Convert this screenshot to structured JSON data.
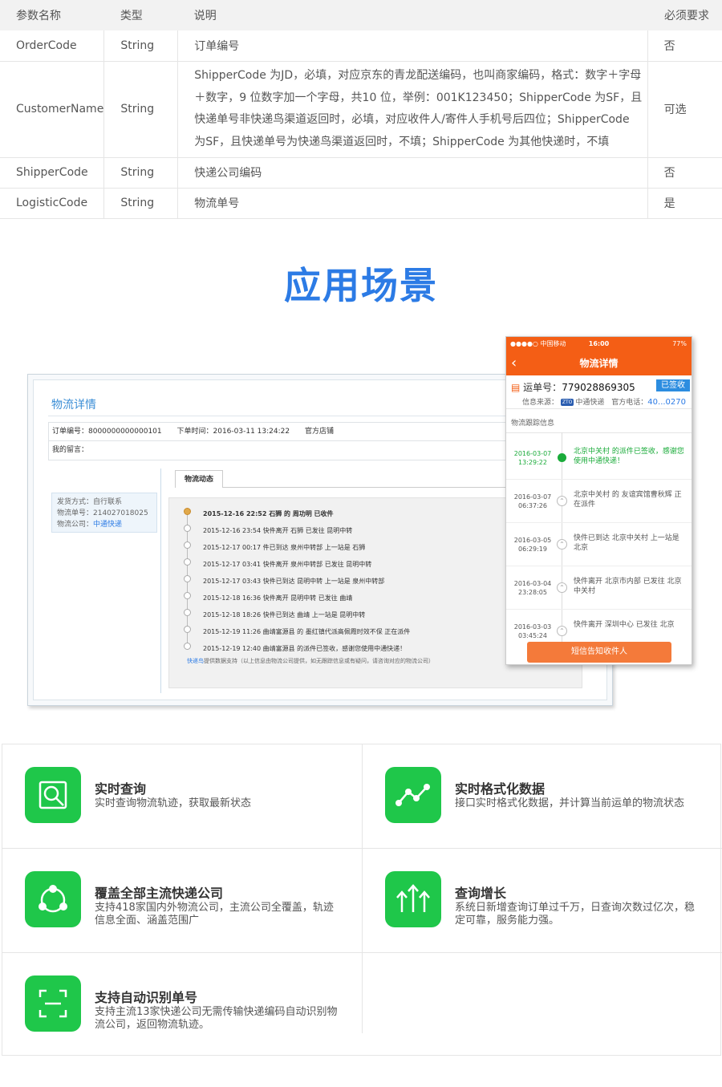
{
  "table": {
    "headers": [
      "参数名称",
      "类型",
      "说明",
      "必须要求"
    ],
    "rows": [
      {
        "name": "OrderCode",
        "type": "String",
        "desc": "订单编号",
        "req": "否"
      },
      {
        "name": "CustomerName",
        "type": "String",
        "desc": "ShipperCode 为JD，必填，对应京东的青龙配送编码，也叫商家编码，格式：数字＋字母＋数字，9 位数字加一个字母，共10 位，举例：001K123450；ShipperCode 为SF，且快递单号非快递鸟渠道返回时，必填，对应收件人/寄件人手机号后四位；ShipperCode 为SF，且快递单号为快递鸟渠道返回时，不填；ShipperCode 为其他快递时，不填",
        "req": "可选"
      },
      {
        "name": "ShipperCode",
        "type": "String",
        "desc": "快递公司编码",
        "req": "否"
      },
      {
        "name": "LogisticCode",
        "type": "String",
        "desc": "物流单号",
        "req": "是"
      }
    ]
  },
  "section_title": "应用场景",
  "web": {
    "title": "物流详情",
    "order_no": "订单编号：8000000000000101",
    "order_time": "下单时间：2016-03-11 13:24:22",
    "store": "官方店铺",
    "message": "我的留言：",
    "ship_method": "发货方式：自行联系",
    "ship_no": "物流单号：214027018025",
    "ship_company_label": "物流公司：",
    "ship_company": "中通快递",
    "tab": "物流动态",
    "track": [
      "2015-12-16 22:52 石狮 的 周功明 已收件",
      "2015-12-16 23:54 快件离开 石狮 已发往 昆明中转",
      "2015-12-17 00:17 件已到达 泉州中转部 上一站是 石狮",
      "2015-12-17 03:41 快件离开 泉州中转部 已发往 昆明中转",
      "2015-12-17 03:43 快件已到达 昆明中转 上一站是 泉州中转部",
      "2015-12-18 16:36 快件离开 昆明中转 已发往 曲靖",
      "2015-12-18 18:26 快件已到达 曲靖 上一站是 昆明中转",
      "2015-12-19 11:26 曲靖富源县 的 墨红镇代派高佩霞时效不保 正在派件",
      "2015-12-19 12:40 曲靖富源县 的派件已签收，感谢您使用中通快递！"
    ],
    "note_link": "快递鸟",
    "note": "提供数据支持（以上信息由物流公司提供，如无跟踪信息或有疑问，请咨询对应的物流公司）"
  },
  "phone": {
    "carrier": "●●●●○ 中国移动",
    "time": "16:00",
    "battery": "77%",
    "nav_title": "物流详情",
    "waybill_label": "运单号：",
    "waybill": "779028869305",
    "signed": "已签收",
    "src_label": "信息来源：",
    "logo": "ZTO",
    "company": "中通快递",
    "tel_label": "官方电话：",
    "tel": "40...0270",
    "section": "物流跟踪信息",
    "rows": [
      {
        "date": "2016-03-07",
        "time": "13:29:22",
        "text": "北京中关村 的派件已签收，感谢您使用中通快递！"
      },
      {
        "date": "2016-03-07",
        "time": "06:37:26",
        "text": "北京中关村 的 友谊宾馆曹秋辉 正在派件"
      },
      {
        "date": "2016-03-05",
        "time": "06:29:19",
        "text": "快件已到达 北京中关村 上一站是 北京"
      },
      {
        "date": "2016-03-04",
        "time": "23:28:05",
        "text": "快件离开 北京市内部 已发往 北京中关村"
      },
      {
        "date": "2016-03-03",
        "time": "03:45:24",
        "text": "快件离开 深圳中心 已发往 北京"
      }
    ],
    "button": "短信告知收件人"
  },
  "features": [
    {
      "title": "实时查询",
      "desc": "实时查询物流轨迹，获取最新状态",
      "icon": "search-doc-icon"
    },
    {
      "title": "实时格式化数据",
      "desc": "接口实时格式化数据，并计算当前运单的物流状态",
      "icon": "line-chart-icon"
    },
    {
      "title": "覆盖全部主流快递公司",
      "desc": "支持418家国内外物流公司，主流公司全覆盖，轨迹信息全面、涵盖范围广",
      "icon": "network-icon"
    },
    {
      "title": "查询增长",
      "desc": "系统日新增查询订单过千万，日查询次数过亿次，稳定可靠，服务能力强。",
      "icon": "growth-arrows-icon"
    },
    {
      "title": "支持自动识别单号",
      "desc": "支持主流13家快递公司无需传输快递编码自动识别物流公司，返回物流轨迹。",
      "icon": "scan-icon"
    }
  ],
  "colors": {
    "accent": "#2c7be5",
    "green": "#1fc74a",
    "orange": "#f45e15"
  }
}
